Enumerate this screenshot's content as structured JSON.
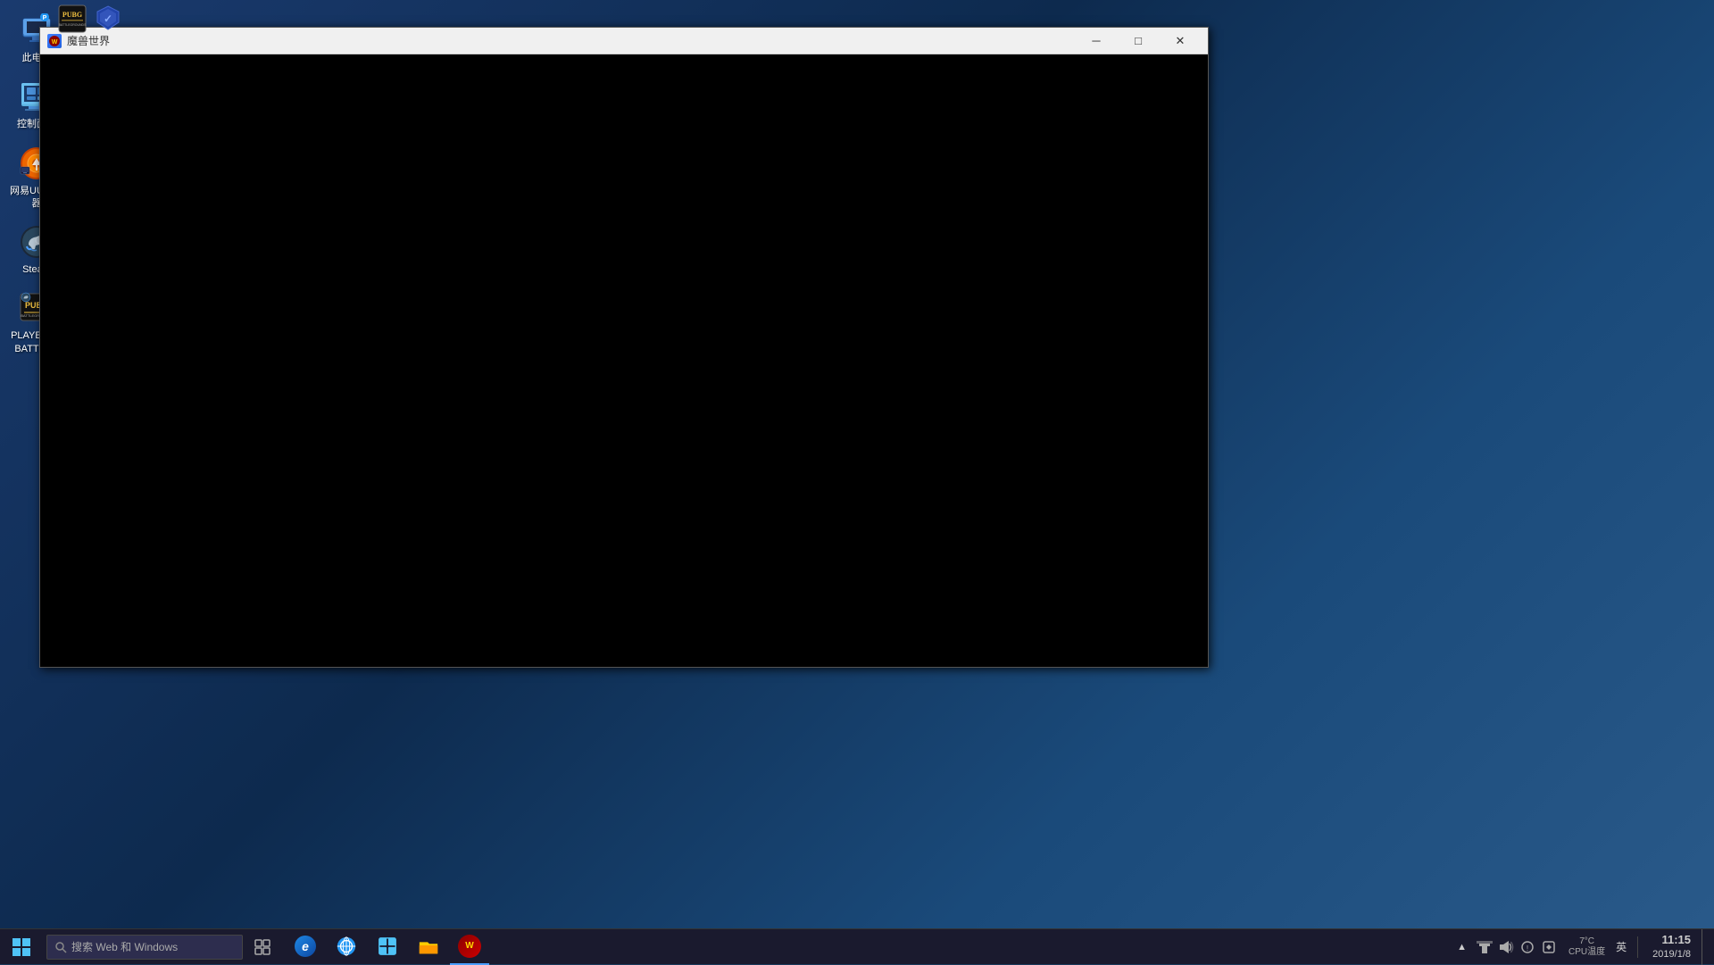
{
  "desktop": {
    "background_color": "#1a3a6e",
    "icons": [
      {
        "id": "recycle-bin",
        "label": "此电脑",
        "type": "recycle-bin"
      },
      {
        "id": "control-panel",
        "label": "控制面板",
        "type": "control"
      },
      {
        "id": "uu-accelerator",
        "label": "网易UU加速器",
        "type": "uu"
      },
      {
        "id": "steam",
        "label": "Steam",
        "type": "steam"
      },
      {
        "id": "pubg",
        "label": "PLAYERUNKNOWN'S BATTLEGROUNDS",
        "label_short": "PLAYERUP BATTLEG",
        "type": "pubg"
      }
    ]
  },
  "topbar": {
    "icons": [
      {
        "id": "pubg-top",
        "type": "pubg"
      },
      {
        "id": "armor-top",
        "type": "armor"
      }
    ]
  },
  "window": {
    "title": "魔兽世界",
    "title_icon": "wow",
    "content": "black",
    "controls": {
      "minimize": "─",
      "maximize": "□",
      "close": "✕"
    }
  },
  "taskbar": {
    "search_placeholder": "搜索 Web 和 Windows",
    "icons": [
      {
        "id": "edge",
        "type": "edge",
        "active": false
      },
      {
        "id": "cortana",
        "type": "cortana",
        "active": false
      },
      {
        "id": "store",
        "type": "store",
        "active": false
      },
      {
        "id": "explorer",
        "type": "explorer",
        "active": false
      },
      {
        "id": "wow-taskbar",
        "type": "wow",
        "active": true
      }
    ],
    "tray": {
      "chevron": "^",
      "cpu_label": "7°C\nCPU温度",
      "network_icon": "network",
      "volume_icon": "volume",
      "datetime": {
        "time": "11:15",
        "date": "2019/1/8"
      },
      "lang": "英"
    }
  }
}
